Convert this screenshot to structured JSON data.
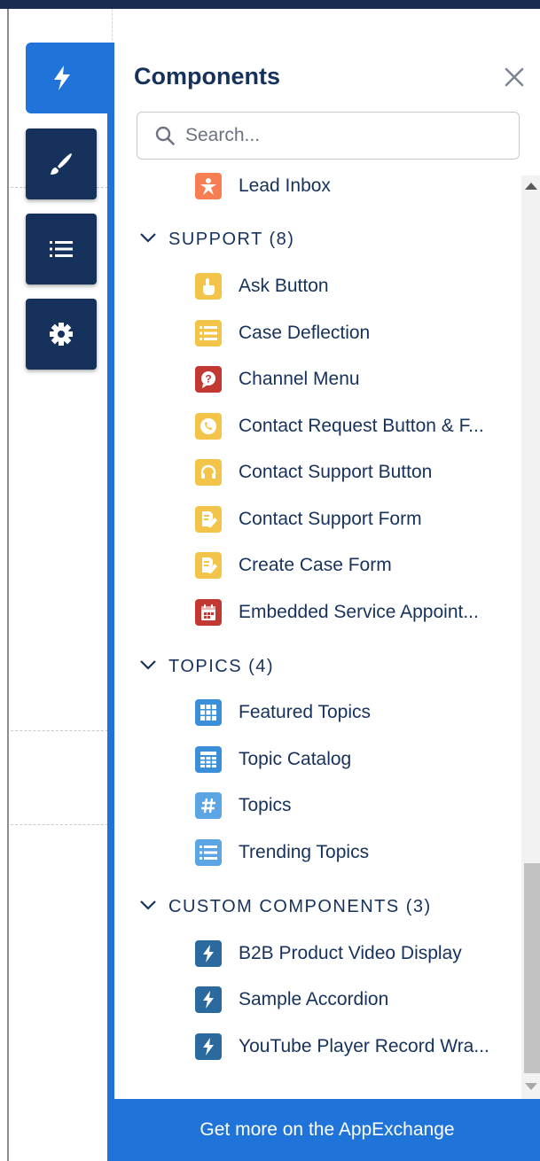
{
  "panel": {
    "title": "Components",
    "close_label": "Close",
    "search_placeholder": "Search...",
    "footer_link": "Get more on the AppExchange"
  },
  "tools": [
    {
      "name": "components",
      "icon": "lightning-icon",
      "active": true
    },
    {
      "name": "theme",
      "icon": "brush-icon",
      "active": false
    },
    {
      "name": "page-structure",
      "icon": "list-icon",
      "active": false
    },
    {
      "name": "settings",
      "icon": "gear-icon",
      "active": false
    }
  ],
  "items": {
    "lead_inbox": "Lead Inbox",
    "support_header": "SUPPORT (8)",
    "ask_button": "Ask Button",
    "case_deflection": "Case Deflection",
    "channel_menu": "Channel Menu",
    "contact_request": "Contact Request Button & F...",
    "contact_support_button": "Contact Support Button",
    "contact_support_form": "Contact Support Form",
    "create_case_form": "Create Case Form",
    "embedded_service": "Embedded Service Appoint...",
    "topics_header": "TOPICS (4)",
    "featured_topics": "Featured Topics",
    "topic_catalog": "Topic Catalog",
    "topics": "Topics",
    "trending_topics": "Trending Topics",
    "custom_header": "CUSTOM COMPONENTS (3)",
    "b2b_video": "B2B Product Video Display",
    "sample_accordion": "Sample Accordion",
    "youtube_player": "YouTube Player Record Wra..."
  },
  "colors": {
    "navy": "#16325c",
    "brand_blue": "#1f73d9",
    "orange": "#f77e53",
    "yellow": "#f2c54a",
    "red": "#c23934",
    "topic_blue": "#5ba5e5",
    "custom_blue": "#2a6a9e"
  }
}
